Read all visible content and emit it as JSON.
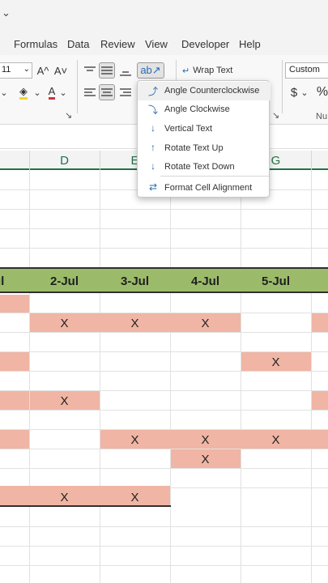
{
  "window": {
    "collapse_glyph": "⌄"
  },
  "menu": {
    "items": [
      "Formulas",
      "Data",
      "Review",
      "View",
      "Developer",
      "Help"
    ]
  },
  "ribbon": {
    "font_size": "11",
    "font_size_dropdown": "⌄",
    "grow_font": "A^",
    "shrink_font": "A˅",
    "fill_color_icon": "◈",
    "font_color_label": "A",
    "wrap_text": "Wrap Text",
    "number_format": "Custom",
    "currency": "$",
    "percent": "%",
    "number_group_label": "Nu",
    "launcher_glyph": "↘",
    "dropdown_arrow": "⌄"
  },
  "orientation_menu": {
    "items": [
      {
        "label": "Angle Counterclockwise",
        "icon": "angle-counterclockwise-icon"
      },
      {
        "label": "Angle Clockwise",
        "icon": "angle-clockwise-icon"
      },
      {
        "label": "Vertical Text",
        "icon": "vertical-text-icon"
      },
      {
        "label": "Rotate Text Up",
        "icon": "rotate-text-up-icon"
      },
      {
        "label": "Rotate Text Down",
        "icon": "rotate-text-down-icon"
      },
      {
        "label": "Format Cell Alignment",
        "icon": "format-cell-alignment-icon"
      }
    ]
  },
  "columns": {
    "headers": [
      "D",
      "E",
      "G"
    ]
  },
  "sheet": {
    "date_headers": [
      "ul",
      "2-Jul",
      "3-Jul",
      "4-Jul",
      "5-Jul"
    ],
    "mark": "X",
    "colors": {
      "header_fill": "#9bbb6a",
      "task_fill": "#f0b5a4",
      "accent": "#217346"
    }
  }
}
